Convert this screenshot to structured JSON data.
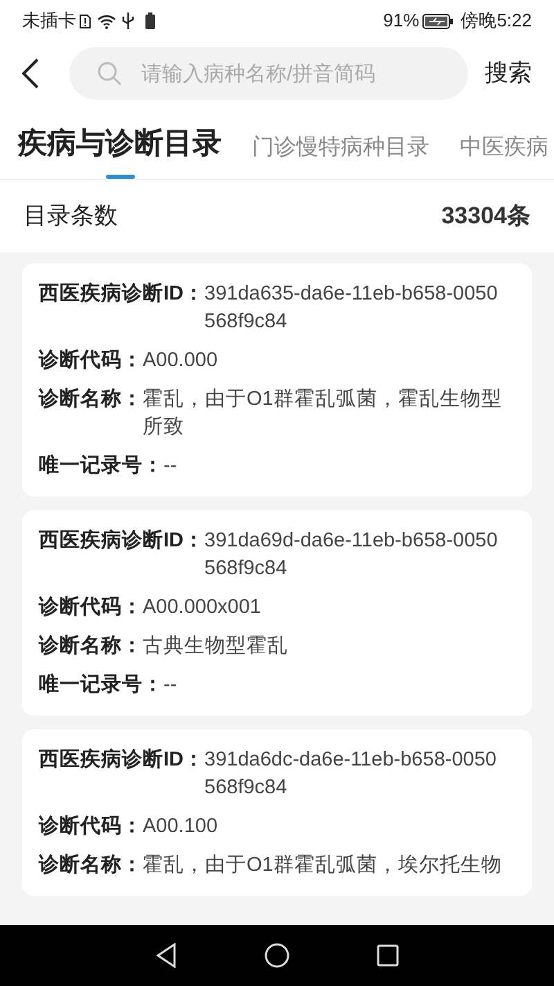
{
  "status_bar": {
    "carrier": "未插卡",
    "battery": "91%",
    "time": "傍晚5:22"
  },
  "search": {
    "placeholder": "请输入病种名称/拼音简码",
    "button": "搜索"
  },
  "tabs": [
    {
      "label": "疾病与诊断目录",
      "selected": true
    },
    {
      "label": "门诊慢特病种目录",
      "selected": false
    },
    {
      "label": "中医疾病",
      "selected": false
    }
  ],
  "summary": {
    "label": "目录条数",
    "value": "33304条"
  },
  "records": [
    {
      "fields": [
        {
          "label": "西医疾病诊断ID：",
          "value": "391da635-da6e-11eb-b658-0050568f9c84"
        },
        {
          "label": "诊断代码：",
          "value": "A00.000"
        },
        {
          "label": "诊断名称：",
          "value": "霍乱，由于O1群霍乱弧菌，霍乱生物型所致"
        },
        {
          "label": "唯一记录号：",
          "value": "--"
        }
      ]
    },
    {
      "fields": [
        {
          "label": "西医疾病诊断ID：",
          "value": "391da69d-da6e-11eb-b658-0050568f9c84"
        },
        {
          "label": "诊断代码：",
          "value": "A00.000x001"
        },
        {
          "label": "诊断名称：",
          "value": "古典生物型霍乱"
        },
        {
          "label": "唯一记录号：",
          "value": "--"
        }
      ]
    },
    {
      "fields": [
        {
          "label": "西医疾病诊断ID：",
          "value": "391da6dc-da6e-11eb-b658-0050568f9c84"
        },
        {
          "label": "诊断代码：",
          "value": "A00.100"
        },
        {
          "label": "诊断名称：",
          "value": "霍乱，由于O1群霍乱弧菌，埃尔托生物"
        }
      ]
    }
  ]
}
